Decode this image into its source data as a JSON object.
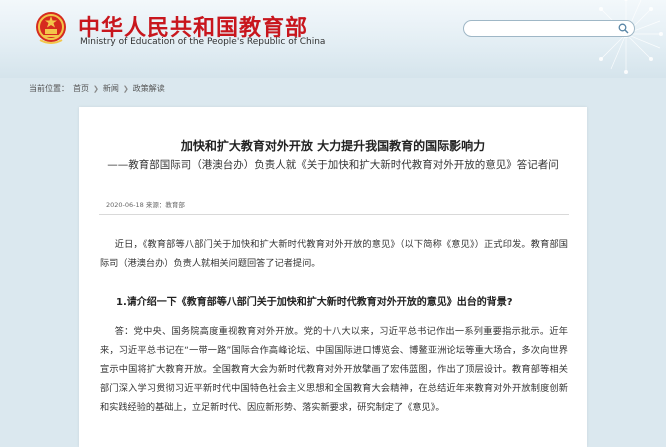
{
  "header": {
    "site_title": "中华人民共和国教育部",
    "site_subtitle": "Ministry of Education of the People's Republic of China",
    "search": {
      "value": "",
      "placeholder": ""
    },
    "icons": {
      "emblem": "national-emblem-icon",
      "search": "search-icon"
    }
  },
  "breadcrumb": {
    "label": "当前位置：",
    "items": [
      "首页",
      "新闻",
      "政策解读"
    ]
  },
  "article": {
    "title": "加快和扩大教育对外开放 大力提升我国教育的国际影响力",
    "subtitle": "——教育部国际司（港澳台办）负责人就《关于加快和扩大新时代教育对外开放的意见》答记者问",
    "meta": "2020-06-18 来源：教育部",
    "para1": "近日，《教育部等八部门关于加快和扩大新时代教育对外开放的意见》（以下简称《意见》）正式印发。教育部国际司（港澳台办）负责人就相关问题回答了记者提问。",
    "question1": "1.请介绍一下《教育部等八部门关于加快和扩大新时代教育对外开放的意见》出台的背景?",
    "para2": "答：党中央、国务院高度重视教育对外开放。党的十八大以来，习近平总书记作出一系列重要指示批示。近年来，习近平总书记在“一带一路”国际合作高峰论坛、中国国际进口博览会、博鳌亚洲论坛等重大场合，多次向世界宣示中国将扩大教育开放。全国教育大会为新时代教育对外开放擘画了宏伟蓝图，作出了顶层设计。教育部等相关部门深入学习贯彻习近平新时代中国特色社会主义思想和全国教育大会精神，在总结近年来教育对外开放制度创新和实践经验的基础上，立足新时代、因应新形势、落实新要求，研究制定了《意见》。"
  },
  "colors": {
    "title_red": "#c8161d",
    "background": "#dbe8ef",
    "panel": "#ffffff"
  }
}
